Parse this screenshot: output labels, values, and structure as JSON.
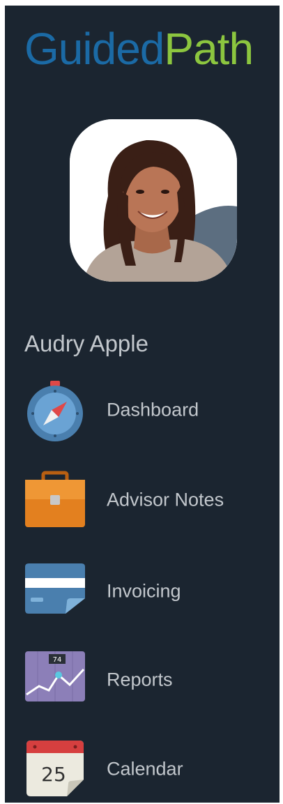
{
  "brand": {
    "part1": "Guided",
    "part2": "Path"
  },
  "user": {
    "name": "Audry Apple"
  },
  "nav": [
    {
      "label": "Dashboard",
      "icon": "compass-icon"
    },
    {
      "label": "Advisor Notes",
      "icon": "briefcase-icon"
    },
    {
      "label": "Invoicing",
      "icon": "credit-card-icon"
    },
    {
      "label": "Reports",
      "icon": "line-chart-icon"
    },
    {
      "label": "Calendar",
      "icon": "calendar-icon"
    }
  ],
  "calendar_icon": {
    "day": "25"
  },
  "reports_icon": {
    "value": "74"
  },
  "colors": {
    "sidebar_bg": "#1b2530",
    "brand_blue": "#1b6aa5",
    "brand_green": "#8cc63f",
    "nav_text": "#c2c7cc"
  }
}
